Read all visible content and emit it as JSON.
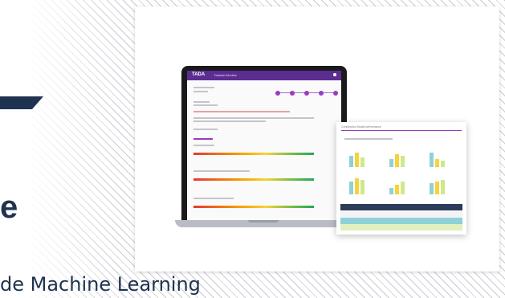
{
  "hero": {
    "title_letter": "e",
    "subtitle": "de Machine Learning"
  },
  "screen": {
    "app_logo": "TADA",
    "app_nav": "Dataset   Models",
    "panel_caption": "Contribution  Model performance"
  },
  "colors": {
    "navy": "#1f3350",
    "purple": "#5c2d91",
    "teal": "#8fd1d6",
    "lime": "#e4efbf"
  }
}
